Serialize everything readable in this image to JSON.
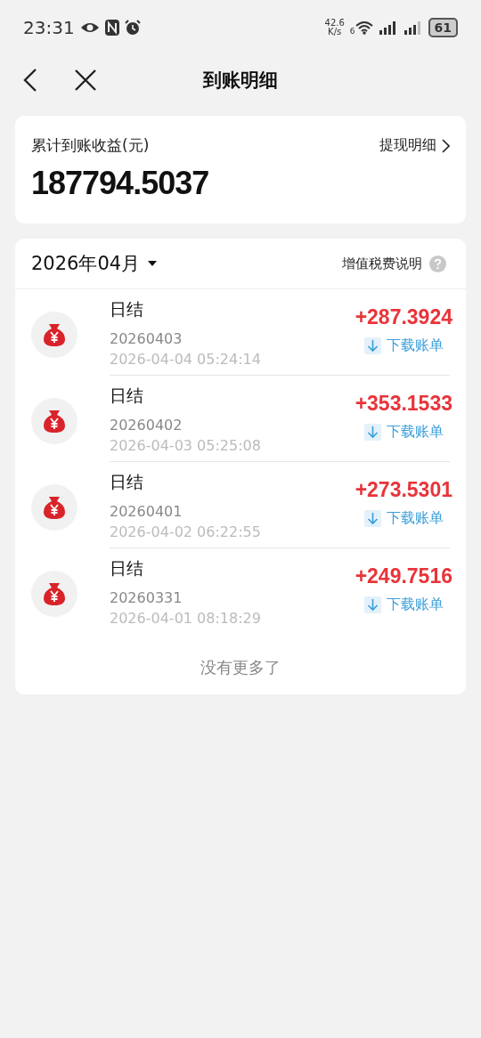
{
  "status_bar": {
    "time": "23:31",
    "net_speed": "42.6",
    "net_unit": "K/s",
    "wifi_badge": "6",
    "battery": "61"
  },
  "nav": {
    "title": "到账明细"
  },
  "summary": {
    "label": "累计到账收益(元)",
    "link": "提现明细",
    "total": "187794.5037"
  },
  "list": {
    "month": "2026年04月",
    "tax_note": "增值税费说明",
    "items": [
      {
        "title": "日结",
        "batch": "20260403",
        "time": "2026-04-04 05:24:14",
        "amount": "+287.3924",
        "download": "下载账单"
      },
      {
        "title": "日结",
        "batch": "20260402",
        "time": "2026-04-03 05:25:08",
        "amount": "+353.1533",
        "download": "下载账单"
      },
      {
        "title": "日结",
        "batch": "20260401",
        "time": "2026-04-02 06:22:55",
        "amount": "+273.5301",
        "download": "下载账单"
      },
      {
        "title": "日结",
        "batch": "20260331",
        "time": "2026-04-01 08:18:29",
        "amount": "+249.7516",
        "download": "下载账单"
      }
    ],
    "end_note": "没有更多了"
  }
}
